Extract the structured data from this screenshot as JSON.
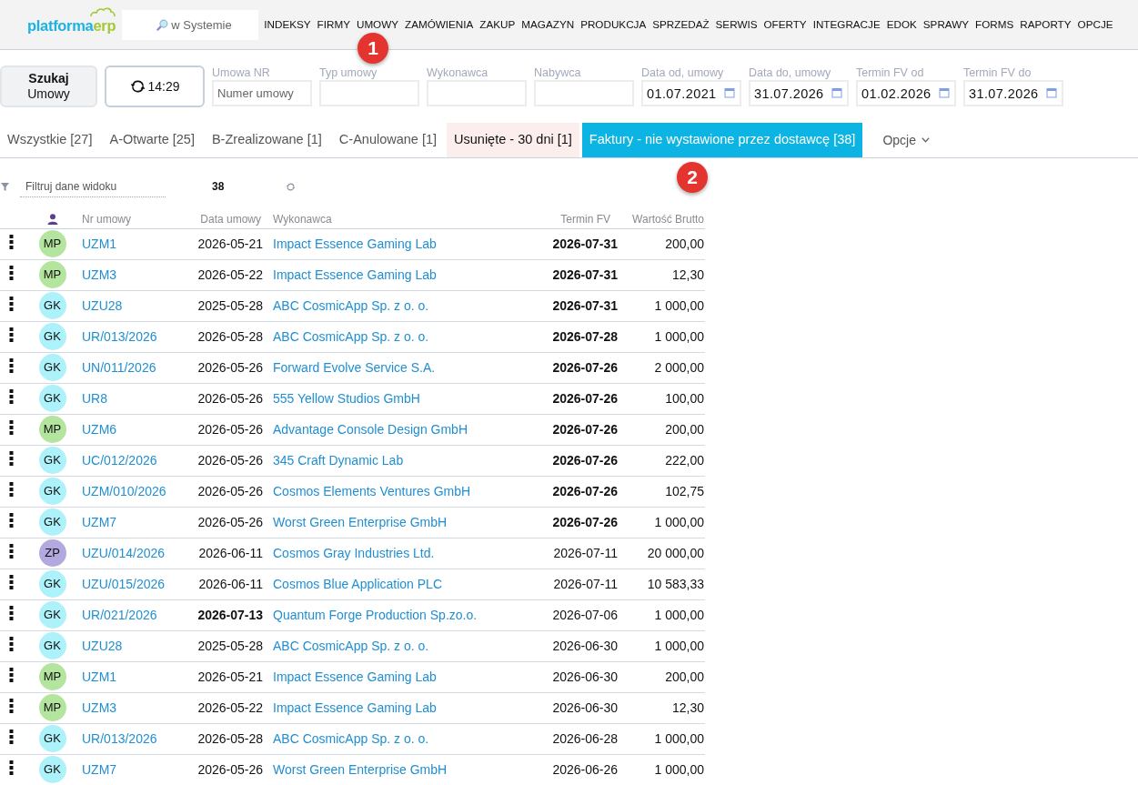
{
  "header": {
    "logo": {
      "text_main": "platforma",
      "text_accent": "erp"
    },
    "search": {
      "placeholder": "w Systemie"
    },
    "menu": [
      {
        "label": "INDEKSY"
      },
      {
        "label": "FIRMY"
      },
      {
        "label": "UMOWY"
      },
      {
        "label": "ZAMÓWIENIA"
      },
      {
        "label": "ZAKUP"
      },
      {
        "label": "MAGAZYN"
      },
      {
        "label": "PRODUKCJA"
      },
      {
        "label": "SPRZEDAŻ"
      },
      {
        "label": "SERWIS"
      },
      {
        "label": "OFERTY"
      },
      {
        "label": "INTEGRACJE"
      },
      {
        "label": "EDOK"
      },
      {
        "label": "SPRAWY"
      },
      {
        "label": "FORMS"
      },
      {
        "label": "RAPORTY"
      },
      {
        "label": "OPCJE"
      }
    ]
  },
  "toolbar": {
    "search_button": {
      "label": "**Szukaj** Umowy"
    },
    "refresh_button": {
      "label": "14:29"
    },
    "fields": [
      {
        "label": "Umowa NR",
        "kind": "text",
        "placeholder": "Numer umowy"
      },
      {
        "label": "Typ umowy",
        "kind": "text"
      },
      {
        "label": "Wykonawca",
        "kind": "text"
      },
      {
        "label": "Nabywca",
        "kind": "text"
      },
      {
        "label": "Data od, umowy",
        "kind": "date",
        "value": "01.07.2021"
      },
      {
        "label": "Data do, umowy",
        "kind": "date",
        "value": "31.07.2026"
      },
      {
        "label": "Termin FV od",
        "kind": "date",
        "value": "01.02.2026"
      },
      {
        "label": "Termin FV do",
        "kind": "date",
        "value": "31.07.2026"
      }
    ]
  },
  "tabs": [
    {
      "label": "Wszystkie [27]",
      "kind": "normal",
      "selected": false
    },
    {
      "label": "A-Otwarte [25]",
      "kind": "normal",
      "selected": false
    },
    {
      "label": "B-Zrealizowane [1]",
      "kind": "normal",
      "selected": false
    },
    {
      "label": "C-Anulowane [1]",
      "kind": "normal",
      "selected": false
    },
    {
      "label": "Usunięte - 30 dni [1]",
      "kind": "deleted",
      "selected": false
    },
    {
      "label": "Faktury - nie wystawione przez dostawcę [38]",
      "kind": "normal",
      "selected": true
    }
  ],
  "options_menu": {
    "label": "Opcje"
  },
  "view_filter": {
    "placeholder": "Filtruj dane widoku",
    "count": "38"
  },
  "table": {
    "columns": [
      "Nr umowy",
      "Data umowy",
      "Wykonawca",
      "Termin FV",
      "Wartość Brutto"
    ],
    "rows": [
      {
        "initials": "MP",
        "color": "#b3e59e",
        "number": "UZM1",
        "date": "2026-05-21",
        "date_emphasized": false,
        "contractor": "Impact Essence Gaming Lab",
        "due": "2026-07-31",
        "due_emphasized": true,
        "gross": "200,00"
      },
      {
        "initials": "MP",
        "color": "#b3e59e",
        "number": "UZM3",
        "date": "2026-05-22",
        "date_emphasized": false,
        "contractor": "Impact Essence Gaming Lab",
        "due": "2026-07-31",
        "due_emphasized": true,
        "gross": "12,30"
      },
      {
        "initials": "GK",
        "color": "#adf1fb",
        "number": "UZU28",
        "date": "2025-05-28",
        "date_emphasized": false,
        "contractor": "ABC CosmicApp Sp. z o. o.",
        "due": "2026-07-31",
        "due_emphasized": true,
        "gross": "1 000,00"
      },
      {
        "initials": "GK",
        "color": "#adf1fb",
        "number": "UR/013/2026",
        "date": "2026-05-28",
        "date_emphasized": false,
        "contractor": "ABC CosmicApp Sp. z o. o.",
        "due": "2026-07-28",
        "due_emphasized": true,
        "gross": "1 000,00"
      },
      {
        "initials": "GK",
        "color": "#adf1fb",
        "number": "UN/011/2026",
        "date": "2026-05-26",
        "date_emphasized": false,
        "contractor": "Forward Evolve Service S.A.",
        "due": "2026-07-26",
        "due_emphasized": true,
        "gross": "2 000,00"
      },
      {
        "initials": "GK",
        "color": "#adf1fb",
        "number": "UR8",
        "date": "2026-05-26",
        "date_emphasized": false,
        "contractor": "555 Yellow Studios GmbH",
        "due": "2026-07-26",
        "due_emphasized": true,
        "gross": "100,00"
      },
      {
        "initials": "MP",
        "color": "#b3e59e",
        "number": "UZM6",
        "date": "2026-05-26",
        "date_emphasized": false,
        "contractor": "Advantage Console Design GmbH",
        "due": "2026-07-26",
        "due_emphasized": true,
        "gross": "200,00"
      },
      {
        "initials": "GK",
        "color": "#adf1fb",
        "number": "UC/012/2026",
        "date": "2026-05-26",
        "date_emphasized": false,
        "contractor": "345 Craft Dynamic Lab",
        "due": "2026-07-26",
        "due_emphasized": true,
        "gross": "222,00"
      },
      {
        "initials": "GK",
        "color": "#adf1fb",
        "number": "UZM/010/2026",
        "date": "2026-05-26",
        "date_emphasized": false,
        "contractor": "Cosmos Elements Ventures GmbH",
        "due": "2026-07-26",
        "due_emphasized": true,
        "gross": "102,75"
      },
      {
        "initials": "GK",
        "color": "#adf1fb",
        "number": "UZM7",
        "date": "2026-05-26",
        "date_emphasized": false,
        "contractor": "Worst Green Enterprise GmbH",
        "due": "2026-07-26",
        "due_emphasized": true,
        "gross": "1 000,00"
      },
      {
        "initials": "ZP",
        "color": "#b4a9df",
        "number": "UZU/014/2026",
        "date": "2026-06-11",
        "date_emphasized": false,
        "contractor": "Cosmos Gray Industries Ltd.",
        "due": "2026-07-11",
        "due_emphasized": false,
        "gross": "20 000,00"
      },
      {
        "initials": "GK",
        "color": "#adf1fb",
        "number": "UZU/015/2026",
        "date": "2026-06-11",
        "date_emphasized": false,
        "contractor": "Cosmos Blue Application PLC",
        "due": "2026-07-11",
        "due_emphasized": false,
        "gross": "10 583,33"
      },
      {
        "initials": "GK",
        "color": "#adf1fb",
        "number": "UR/021/2026",
        "date": "2026-07-13",
        "date_emphasized": true,
        "contractor": "Quantum Forge Production Sp.zo.o.",
        "due": "2026-07-06",
        "due_emphasized": false,
        "gross": "1 000,00"
      },
      {
        "initials": "GK",
        "color": "#adf1fb",
        "number": "UZU28",
        "date": "2025-05-28",
        "date_emphasized": false,
        "contractor": "ABC CosmicApp Sp. z o. o.",
        "due": "2026-06-30",
        "due_emphasized": false,
        "gross": "1 000,00"
      },
      {
        "initials": "MP",
        "color": "#b3e59e",
        "number": "UZM1",
        "date": "2026-05-21",
        "date_emphasized": false,
        "contractor": "Impact Essence Gaming Lab",
        "due": "2026-06-30",
        "due_emphasized": false,
        "gross": "200,00"
      },
      {
        "initials": "MP",
        "color": "#b3e59e",
        "number": "UZM3",
        "date": "2026-05-22",
        "date_emphasized": false,
        "contractor": "Impact Essence Gaming Lab",
        "due": "2026-06-30",
        "due_emphasized": false,
        "gross": "12,30"
      },
      {
        "initials": "GK",
        "color": "#adf1fb",
        "number": "UR/013/2026",
        "date": "2026-05-28",
        "date_emphasized": false,
        "contractor": "ABC CosmicApp Sp. z o. o.",
        "due": "2026-06-28",
        "due_emphasized": false,
        "gross": "1 000,00"
      },
      {
        "initials": "GK",
        "color": "#adf1fb",
        "number": "UZM7",
        "date": "2026-05-26",
        "date_emphasized": false,
        "contractor": "Worst Green Enterprise GmbH",
        "due": "2026-06-26",
        "due_emphasized": false,
        "gross": "1 000,00"
      }
    ]
  },
  "callouts": [
    {
      "label": "1"
    },
    {
      "label": "2"
    }
  ]
}
